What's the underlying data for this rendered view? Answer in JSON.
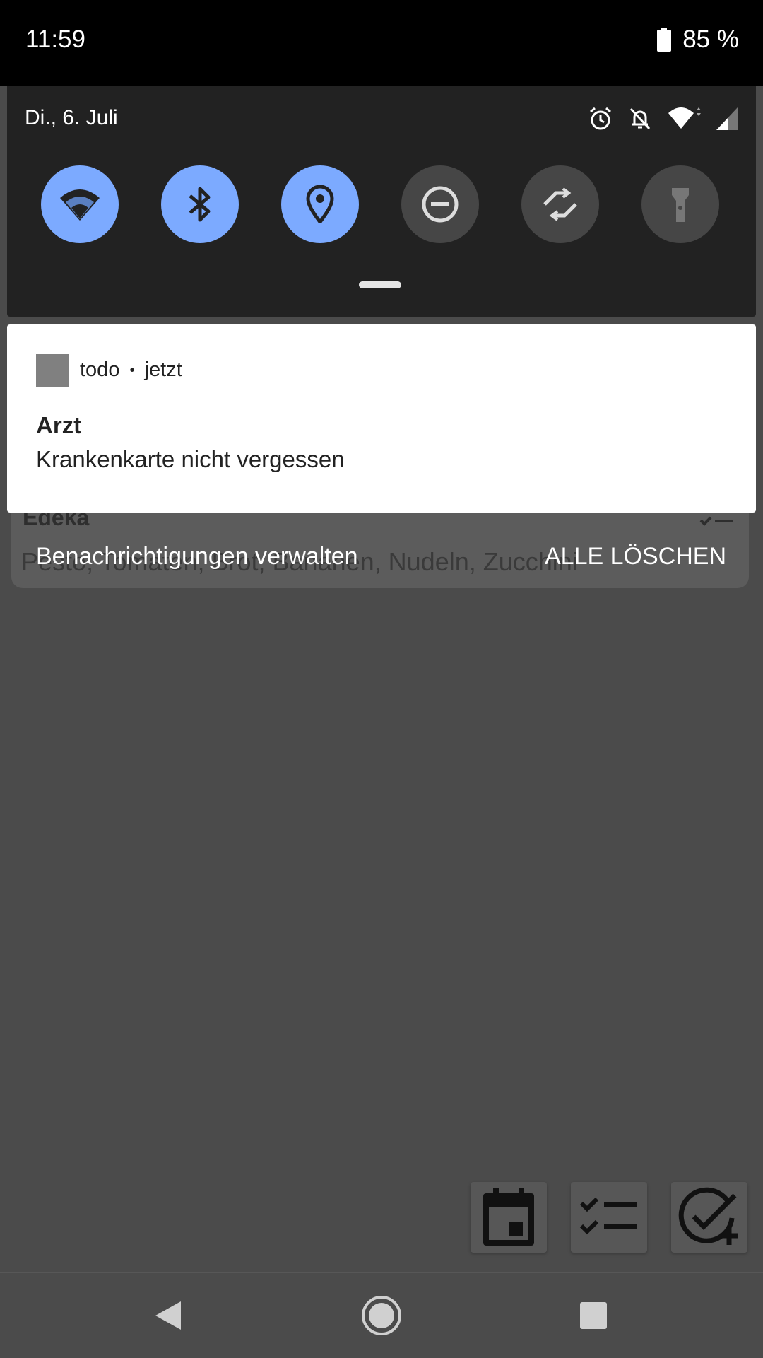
{
  "status_bar": {
    "time": "11:59",
    "battery": "85 %",
    "icons": [
      "battery-icon"
    ]
  },
  "quick_settings": {
    "date": "Di., 6. Juli",
    "status_icons": [
      "alarm-icon",
      "notifications-off-icon",
      "wifi-icon",
      "signal-icon"
    ],
    "tiles": [
      {
        "name": "wifi",
        "icon": "wifi-icon",
        "state": "on"
      },
      {
        "name": "bluetooth",
        "icon": "bluetooth-icon",
        "state": "on"
      },
      {
        "name": "location",
        "icon": "location-icon",
        "state": "on"
      },
      {
        "name": "do-not-disturb",
        "icon": "do-not-disturb-icon",
        "state": "off"
      },
      {
        "name": "auto-rotate",
        "icon": "auto-rotate-icon",
        "state": "off"
      },
      {
        "name": "flashlight",
        "icon": "flashlight-icon",
        "state": "off"
      }
    ]
  },
  "notification": {
    "app_name": "todo",
    "separator": "•",
    "time": "jetzt",
    "title": "Arzt",
    "text": "Krankenkarte nicht vergessen"
  },
  "notification_footer": {
    "manage_label": "Benachrichtigungen verwalten",
    "clear_all_label": "ALLE LÖSCHEN"
  },
  "background_app": {
    "card_title": "Edeka",
    "card_body": "Pesto, Tomaten, Brot, Bananen, Nudeln, Zucchini",
    "toolbar": [
      "calendar-icon",
      "checklist-icon",
      "add-task-icon"
    ]
  },
  "nav_bar": {
    "buttons": [
      "back-icon",
      "home-icon",
      "recents-icon"
    ]
  },
  "colors": {
    "tile_on": "#7caaff",
    "tile_off": "#464646",
    "panel": "#222222",
    "scrim": "#4b4b4b"
  }
}
